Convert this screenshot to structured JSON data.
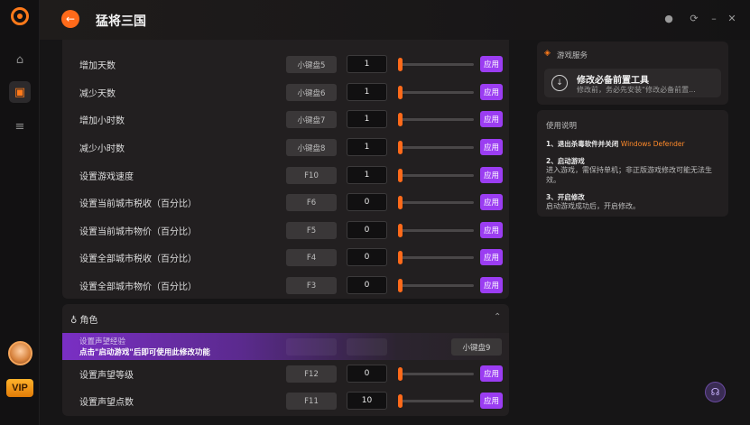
{
  "app": {
    "game_title": "猛将三国",
    "vip_label": "VIP"
  },
  "rows": [
    {
      "label": "增加天数",
      "hotkey": "小键盘5",
      "value": "1",
      "apply": "应用"
    },
    {
      "label": "减少天数",
      "hotkey": "小键盘6",
      "value": "1",
      "apply": "应用"
    },
    {
      "label": "增加小时数",
      "hotkey": "小键盘7",
      "value": "1",
      "apply": "应用"
    },
    {
      "label": "减少小时数",
      "hotkey": "小键盘8",
      "value": "1",
      "apply": "应用"
    },
    {
      "label": "设置游戏速度",
      "hotkey": "F10",
      "value": "1",
      "apply": "应用"
    },
    {
      "label": "设置当前城市税收（百分比）",
      "hotkey": "F6",
      "value": "0",
      "apply": "应用"
    },
    {
      "label": "设置当前城市物价（百分比）",
      "hotkey": "F5",
      "value": "0",
      "apply": "应用"
    },
    {
      "label": "设置全部城市税收（百分比）",
      "hotkey": "F4",
      "value": "0",
      "apply": "应用"
    },
    {
      "label": "设置全部城市物价（百分比）",
      "hotkey": "F3",
      "value": "0",
      "apply": "应用"
    }
  ],
  "character": {
    "section_title": "角色",
    "locked_row": {
      "label": "设置声望经验",
      "notice": "点击\"启动游戏\"后即可使用此修改功能",
      "hotkey": "小键盘9"
    },
    "rows": [
      {
        "label": "设置声望等级",
        "hotkey": "F12",
        "value": "0",
        "apply": "应用"
      },
      {
        "label": "设置声望点数",
        "hotkey": "F11",
        "value": "10",
        "apply": "应用"
      }
    ]
  },
  "service": {
    "title": "游戏服务",
    "tool_name": "修改必备前置工具",
    "tool_desc": "修改前，务必先安装“修改必备前置..."
  },
  "usage": {
    "title": "使用说明",
    "step1_title": "1、退出杀毒软件并关闭",
    "step1_highlight": "Windows Defender",
    "step2_title": "2、启动游戏",
    "step2_desc": "进入游戏，需保持单机；非正版游戏修改可能无法生效。",
    "step3_title": "3、开启修改",
    "step3_desc": "启动游戏成功后，开启修改。"
  },
  "colors": {
    "accent_orange": "#ff6a1a",
    "apply_purple": "#9b3df2"
  }
}
